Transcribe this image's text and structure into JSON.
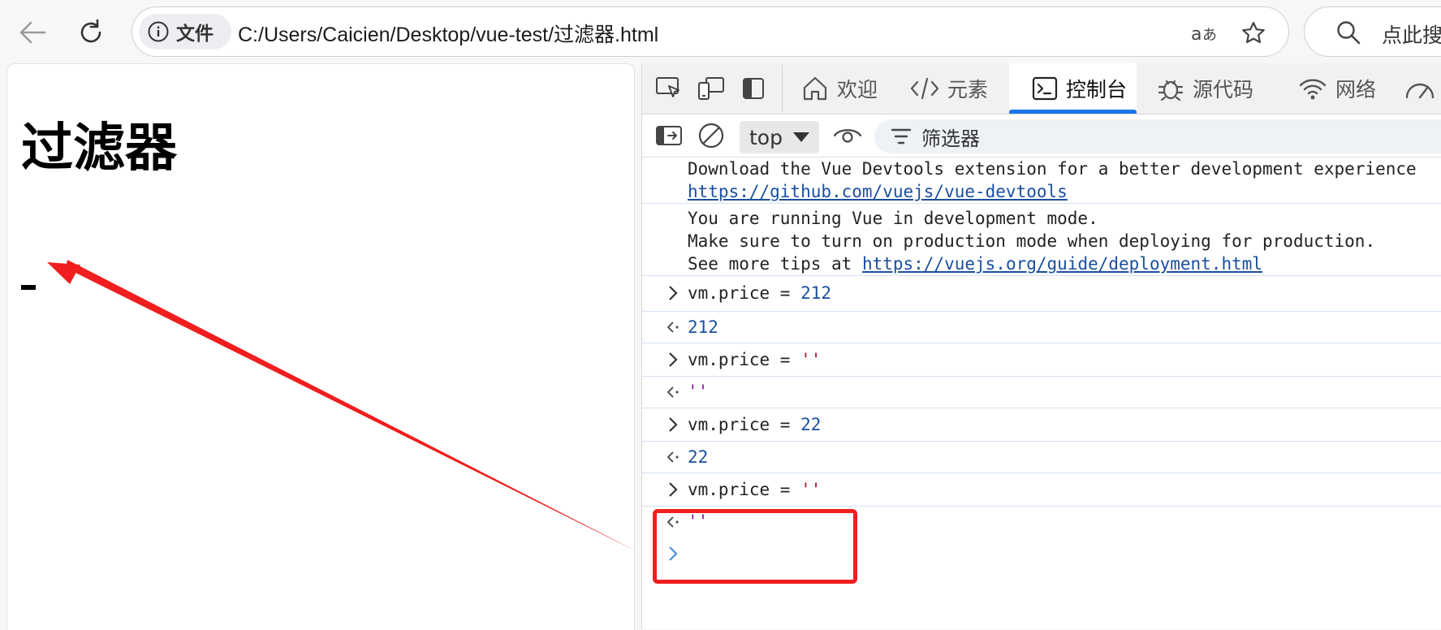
{
  "browser": {
    "security_label": "文件",
    "url": "C:/Users/Caicien/Desktop/vue-test/过滤器.html",
    "search_placeholder": "点此搜"
  },
  "page": {
    "heading": "过滤器",
    "output": "-"
  },
  "devtools": {
    "tabs": [
      {
        "label": "欢迎",
        "icon": "home-icon"
      },
      {
        "label": "元素",
        "icon": "code-icon"
      },
      {
        "label": "控制台",
        "icon": "console-icon"
      },
      {
        "label": "源代码",
        "icon": "bug-icon"
      },
      {
        "label": "网络",
        "icon": "wifi-icon"
      }
    ],
    "active_tab": "控制台",
    "context": "top",
    "filter_label": "筛选器"
  },
  "console": {
    "devtools_msg": "Download the Vue Devtools extension for a better development experience",
    "devtools_link": "https://github.com/vuejs/vue-devtools",
    "dev_mode_line1": "You are running Vue in development mode.",
    "dev_mode_line2": "Make sure to turn on production mode when deploying for production.",
    "dev_mode_line3_prefix": "See more tips at ",
    "dev_mode_link": "https://vuejs.org/guide/deployment.html",
    "entries": [
      {
        "input_code": "vm.price = ",
        "input_value": "212",
        "result": "212"
      },
      {
        "input_code": "vm.price = ",
        "input_value": "''",
        "result": "''"
      },
      {
        "input_code": "vm.price = ",
        "input_value": "22",
        "result": "22"
      },
      {
        "input_code": "vm.price = ",
        "input_value": "''",
        "result": "''"
      }
    ]
  },
  "colors": {
    "accent": "#1a73e8",
    "annotation": "#f01e1e",
    "number": "#1a4fa0",
    "string": "#b2162d"
  }
}
